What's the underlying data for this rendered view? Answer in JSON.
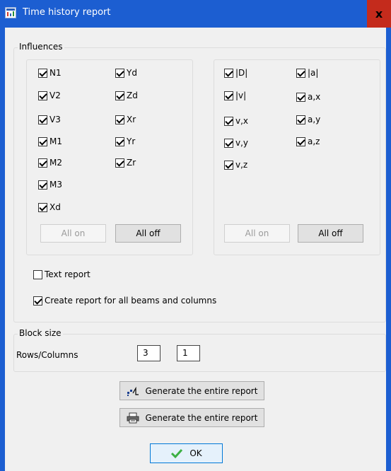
{
  "window": {
    "title": "Time history report",
    "close_glyph": "x",
    "title_icon": "report-app-icon"
  },
  "influences": {
    "label": "Influences",
    "forces": {
      "col1": [
        {
          "label": "N1",
          "checked": true
        },
        {
          "label": "V2",
          "checked": true
        },
        {
          "label": "V3",
          "checked": true
        },
        {
          "label": "M1",
          "checked": true
        },
        {
          "label": "M2",
          "checked": true
        },
        {
          "label": "M3",
          "checked": true
        },
        {
          "label": "Xd",
          "checked": true
        }
      ],
      "col2": [
        {
          "label": "Yd",
          "checked": true
        },
        {
          "label": "Zd",
          "checked": true
        },
        {
          "label": "Xr",
          "checked": true
        },
        {
          "label": "Yr",
          "checked": true
        },
        {
          "label": "Zr",
          "checked": true
        }
      ],
      "all_on": "All on",
      "all_off": "All off"
    },
    "motion": {
      "col1": [
        {
          "label": "|D|",
          "checked": true
        },
        {
          "label": "|v|",
          "checked": true
        },
        {
          "label": "v,x",
          "checked": true
        },
        {
          "label": "v,y",
          "checked": true
        },
        {
          "label": "v,z",
          "checked": true
        }
      ],
      "col2": [
        {
          "label": "|a|",
          "checked": true
        },
        {
          "label": "a,x",
          "checked": true
        },
        {
          "label": "a,y",
          "checked": true
        },
        {
          "label": "a,z",
          "checked": true
        }
      ],
      "all_on": "All on",
      "all_off": "All off"
    },
    "text_report": {
      "label": "Text report",
      "checked": false
    },
    "all_beams": {
      "label": "Create report for all beams and columns",
      "checked": true
    }
  },
  "block_size": {
    "label": "Block size",
    "rows_columns_label": "Rows/Columns",
    "rows": "3",
    "columns": "1"
  },
  "actions": {
    "generate_chart": {
      "label": "Generate the entire report",
      "icon": "chart-report-icon"
    },
    "generate_print": {
      "label": "Generate the entire report",
      "icon": "printer-icon"
    },
    "ok": {
      "label": "OK",
      "icon": "checkmark-icon",
      "icon_color": "#3cb043"
    }
  }
}
